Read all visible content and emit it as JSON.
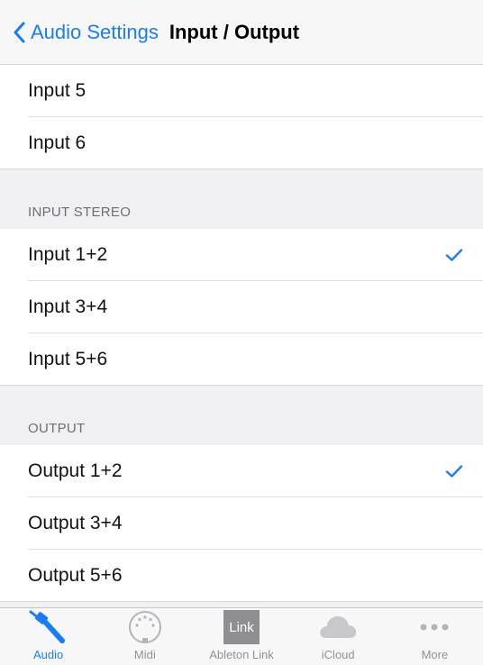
{
  "navbar": {
    "back_label": "Audio Settings",
    "title": "Input / Output"
  },
  "top_group": {
    "items": [
      {
        "label": "Input 5",
        "checked": false
      },
      {
        "label": "Input 6",
        "checked": false
      }
    ]
  },
  "input_stereo": {
    "header": "INPUT STEREO",
    "items": [
      {
        "label": "Input 1+2",
        "checked": true
      },
      {
        "label": "Input 3+4",
        "checked": false
      },
      {
        "label": "Input 5+6",
        "checked": false
      }
    ]
  },
  "output": {
    "header": "OUTPUT",
    "items": [
      {
        "label": "Output 1+2",
        "checked": true
      },
      {
        "label": "Output 3+4",
        "checked": false
      },
      {
        "label": "Output 5+6",
        "checked": false
      }
    ]
  },
  "tabbar": {
    "tabs": [
      {
        "label": "Audio",
        "icon": "audio-cable-icon",
        "active": true
      },
      {
        "label": "Midi",
        "icon": "midi-connector-icon",
        "active": false
      },
      {
        "label": "Ableton Link",
        "icon_text": "Link",
        "icon": "ableton-link-icon",
        "active": false
      },
      {
        "label": "iCloud",
        "icon": "cloud-icon",
        "active": false
      },
      {
        "label": "More",
        "icon": "more-dots-icon",
        "active": false
      }
    ]
  },
  "colors": {
    "accent": "#1a7cf4",
    "background": "#efeff4",
    "inactive_tab": "#929292"
  }
}
